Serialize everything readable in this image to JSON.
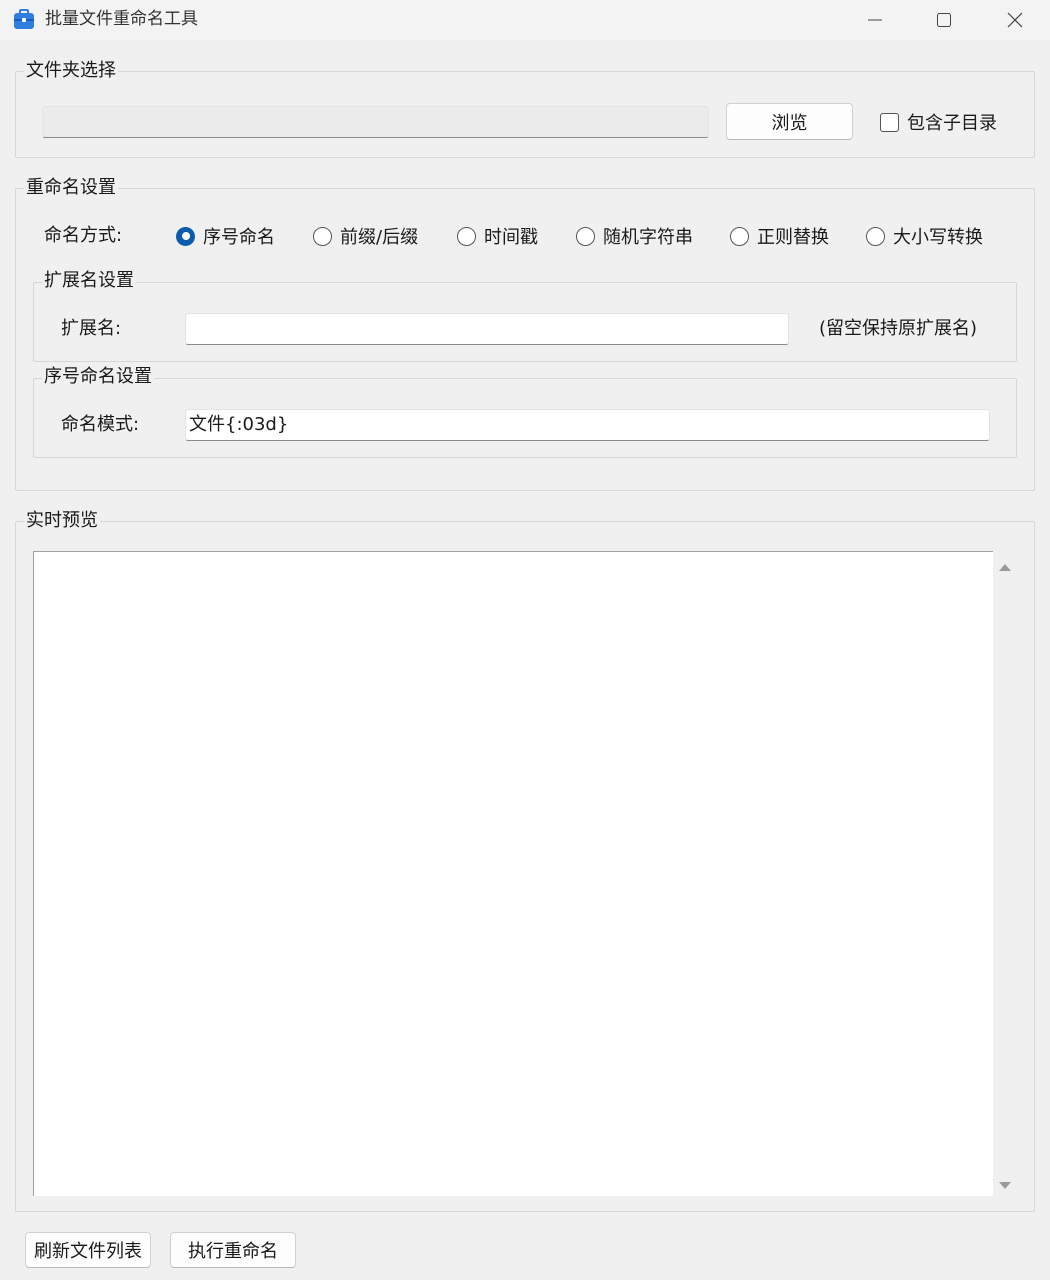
{
  "window": {
    "title": "批量文件重命名工具",
    "icon": "toolbox-icon",
    "controls": [
      "minimize-icon",
      "maximize-icon",
      "close-icon"
    ]
  },
  "folder_group": {
    "label": "文件夹选择",
    "path_value": "",
    "browse_label": "浏览",
    "include_subdirs_label": "包含子目录",
    "include_subdirs_checked": false
  },
  "rename_group": {
    "label": "重命名设置",
    "mode_label": "命名方式:",
    "modes": [
      {
        "label": "序号命名",
        "checked": true
      },
      {
        "label": "前缀/后缀",
        "checked": false
      },
      {
        "label": "时间戳",
        "checked": false
      },
      {
        "label": "随机字符串",
        "checked": false
      },
      {
        "label": "正则替换",
        "checked": false
      },
      {
        "label": "大小写转换",
        "checked": false
      }
    ],
    "extension_group": {
      "label": "扩展名设置",
      "field_label": "扩展名:",
      "value": "",
      "hint": "(留空保持原扩展名)"
    },
    "sequence_group": {
      "label": "序号命名设置",
      "field_label": "命名模式:",
      "value": "文件{:03d}"
    }
  },
  "preview_group": {
    "label": "实时预览",
    "content": ""
  },
  "actions": {
    "refresh_label": "刷新文件列表",
    "execute_label": "执行重命名"
  },
  "colors": {
    "accent": "#0b5cad",
    "background": "#f0f0f0",
    "icon_blue": "#2f7de1"
  }
}
